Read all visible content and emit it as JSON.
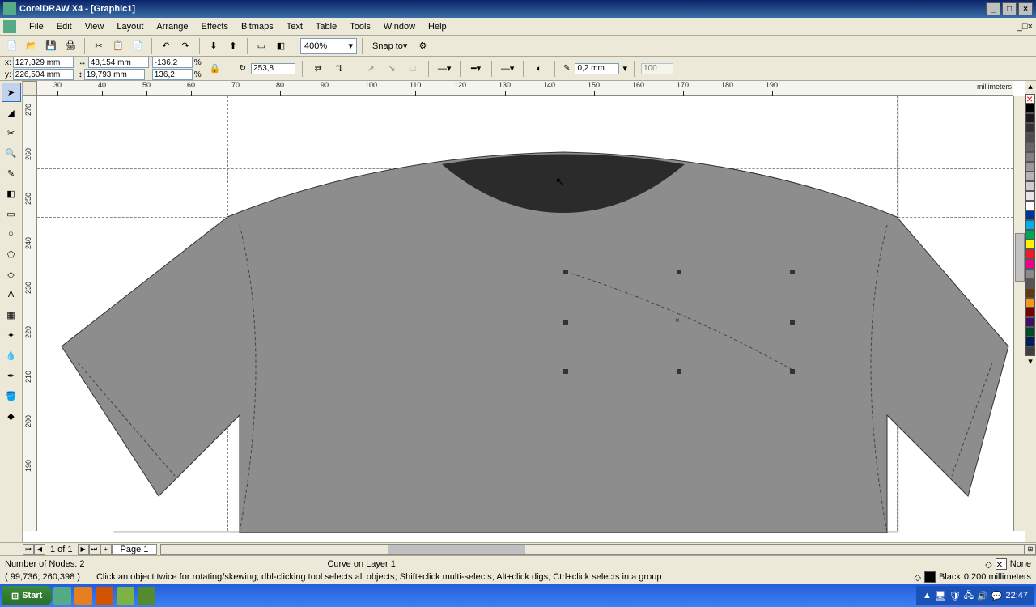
{
  "title": "CorelDRAW X4 - [Graphic1]",
  "menu": [
    "File",
    "Edit",
    "View",
    "Layout",
    "Arrange",
    "Effects",
    "Bitmaps",
    "Text",
    "Table",
    "Tools",
    "Window",
    "Help"
  ],
  "zoom": "400%",
  "snap": "Snap to",
  "coord": {
    "xl": "x:",
    "xv": "127,329 mm",
    "yl": "y:",
    "yv": "226,504 mm",
    "wv": "48,154 mm",
    "hv": "19,793 mm",
    "sxv": "-136,2",
    "pct": "%",
    "syv": "136,2",
    "rot": "253,8",
    "outline": "0,2 mm",
    "opacity": "100"
  },
  "ruler_h": [
    30,
    40,
    50,
    60,
    70,
    80,
    90,
    100,
    110,
    120,
    130,
    140,
    150,
    160,
    170,
    180,
    190
  ],
  "ruler_v": [
    270,
    260,
    250,
    240,
    230,
    220,
    210,
    200,
    190
  ],
  "ruler_unit": "millimeters",
  "pages": "1 of 1",
  "page_tab": "Page 1",
  "status": {
    "nodes": "Number of Nodes: 2",
    "layer": "Curve on Layer 1",
    "cursor": "( 99,736; 260,398 )",
    "hint": "Click an object twice for rotating/skewing; dbl-clicking tool selects all objects; Shift+click multi-selects; Alt+click digs; Ctrl+click selects in a group",
    "fill": "None",
    "outline_c": "Black",
    "outline_w": "0,200 millimeters"
  },
  "palette": [
    "#ffffff",
    "#000000",
    "#1a1a1a",
    "#333333",
    "#4d4d4d",
    "#666666",
    "#808080",
    "#999999",
    "#b3b3b3",
    "#cccccc",
    "#e6e6e6",
    "#0000ff",
    "#00ff00",
    "#00ffff",
    "#ff0000",
    "#ff00ff",
    "#ffff00",
    "#3333ff",
    "#33ff33",
    "#663399",
    "#996633",
    "#cc6600",
    "#aa0000",
    "#666600",
    "#006666",
    "#330066",
    "#660033"
  ],
  "taskbar": {
    "start": "Start",
    "time": "22:47"
  }
}
